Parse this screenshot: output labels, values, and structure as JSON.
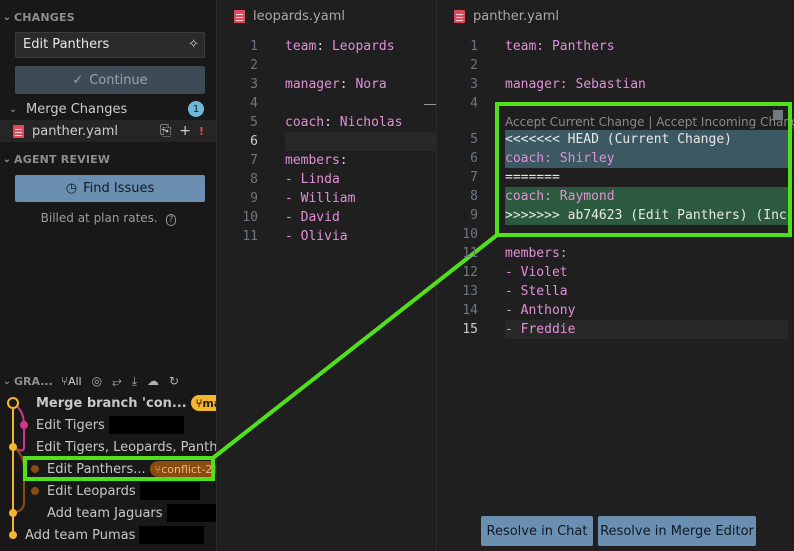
{
  "sidebar": {
    "changes_header": "CHANGES",
    "commit_message": "Edit Panthers",
    "continue_label": "Continue",
    "merge_changes_label": "Merge Changes",
    "merge_changes_count": "1",
    "conflict_file": "panther.yaml",
    "conflict_marker": "!",
    "agent_review_header": "AGENT REVIEW",
    "find_issues_label": "Find Issues",
    "billed_text": "Billed at plan rates.",
    "graph_header": "GRA...",
    "graph_filter": "All"
  },
  "graph": {
    "commits": [
      {
        "message": "Merge branch 'con...",
        "tag": "main",
        "bold": true
      },
      {
        "message": "Edit Tigers",
        "tag": ""
      },
      {
        "message": "Edit Tigers, Leopards, Panth...",
        "tag": ""
      },
      {
        "message": "Edit Panthers...",
        "tag": "conflict-2"
      },
      {
        "message": "Edit Leopards",
        "tag": ""
      },
      {
        "message": "Add team Jaguars",
        "tag": ""
      },
      {
        "message": "Add team Pumas",
        "tag": ""
      }
    ]
  },
  "left_editor": {
    "tab": "leopards.yaml",
    "lines": [
      {
        "n": "1",
        "key": "team",
        "val": "Leopards"
      },
      {
        "n": "2",
        "key": "",
        "val": ""
      },
      {
        "n": "3",
        "key": "manager",
        "val": "Nora"
      },
      {
        "n": "4",
        "key": "",
        "val": ""
      },
      {
        "n": "5",
        "key": "coach",
        "val": "Nicholas"
      },
      {
        "n": "6",
        "key": "",
        "val": ""
      },
      {
        "n": "7",
        "key": "members",
        "val": ""
      },
      {
        "n": "8",
        "key": "- ",
        "val": "Linda"
      },
      {
        "n": "9",
        "key": "- ",
        "val": "William"
      },
      {
        "n": "10",
        "key": "- ",
        "val": "David"
      },
      {
        "n": "11",
        "key": "- ",
        "val": "Olivia"
      }
    ]
  },
  "right_editor": {
    "tab": "panther.yaml",
    "codelens": "Accept Current Change | Accept Incoming Change | A",
    "lines": [
      {
        "n": "1",
        "text": "team: Panthers"
      },
      {
        "n": "2",
        "text": ""
      },
      {
        "n": "3",
        "text": "manager: Sebastian"
      },
      {
        "n": "4",
        "text": ""
      },
      {
        "n": "5",
        "text": "<<<<<<< HEAD (Current Change)"
      },
      {
        "n": "6",
        "text": "coach: Shirley"
      },
      {
        "n": "7",
        "text": "======="
      },
      {
        "n": "8",
        "text": "coach: Raymond"
      },
      {
        "n": "9",
        "text": ">>>>>>> ab74623 (Edit Panthers) (Inc"
      },
      {
        "n": "10",
        "text": ""
      },
      {
        "n": "11",
        "text": "members:"
      },
      {
        "n": "12",
        "text": "- Violet"
      },
      {
        "n": "13",
        "text": "- Stella"
      },
      {
        "n": "14",
        "text": "- Anthony"
      },
      {
        "n": "15",
        "text": "- Freddie"
      }
    ],
    "resolve_chat_label": "Resolve in Chat",
    "resolve_merge_label": "Resolve in Merge Editor"
  },
  "colors": {
    "annotation": "#52e01a",
    "current_change": "#3b5863",
    "incoming_change": "#2b5a3f",
    "button": "#6b8fb0"
  }
}
